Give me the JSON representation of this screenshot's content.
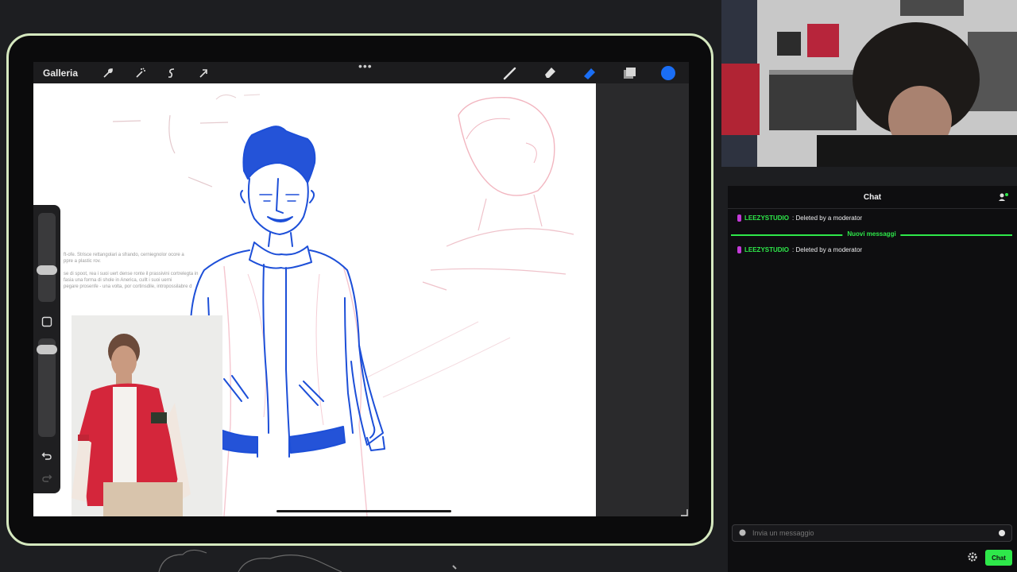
{
  "app": {
    "gallery_label": "Galleria",
    "toolbar_icons": [
      "wrench-icon",
      "magic-wand-icon",
      "selection-icon",
      "transform-arrow-icon"
    ],
    "tools": [
      "brush-icon",
      "smudge-icon",
      "eraser-icon",
      "layers-icon"
    ],
    "active_tool": "eraser-icon",
    "current_color": "#1a6ef5",
    "reference_text": [
      "ft-ofe. Strisce rettangolari a sfrando, cerniegnolor ocore a",
      "ppre a plastic rov.",
      "",
      "se di spoot, rea i suoi uert dense ronte il prassivini cortrelegta in",
      "fasia una forma di shole in Anerica, cullt i suoi uerni",
      "pegare prosenfe - una volta, por cortinsdile, intropossilabre d"
    ]
  },
  "chat": {
    "title": "Chat",
    "messages": [
      {
        "user": "LEEZYSTUDIO",
        "text": ": Deleted by a moderator"
      },
      {
        "user": "LEEZYSTUDIO",
        "text": ": Deleted by a moderator"
      }
    ],
    "divider_label": "Nuovi messaggi",
    "input_placeholder": "Invia un messaggio",
    "send_label": "Chat",
    "colors": {
      "accent": "#2ee84a",
      "badge": "#c43bd9"
    }
  }
}
